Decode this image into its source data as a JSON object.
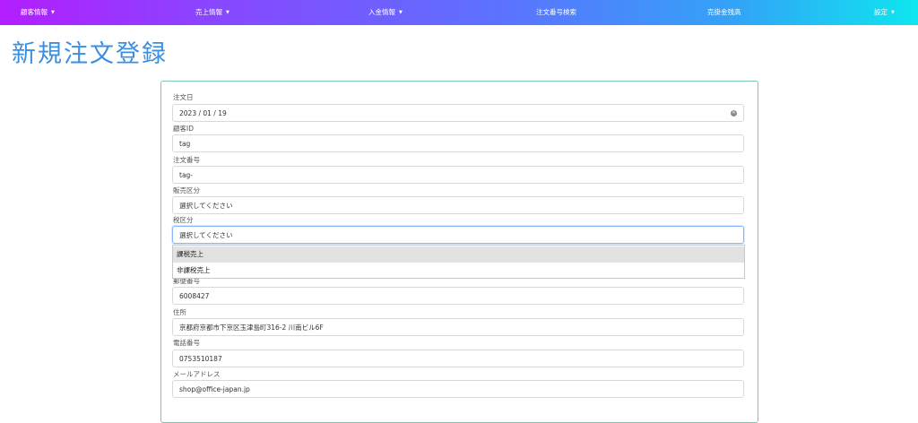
{
  "nav": {
    "customer": "顧客情報",
    "sales": "売上情報",
    "payment": "入金情報",
    "order_search": "注文番号検索",
    "receivable": "売掛金残高",
    "settings": "設定"
  },
  "page_title": "新規注文登録",
  "form": {
    "order_date_label": "注文日",
    "order_date_value": "2023 / 01 / 19",
    "customer_id_label": "顧客ID",
    "customer_id_value": "tag",
    "order_no_label": "注文番号",
    "order_no_value": "tag-",
    "sales_type_label": "販売区分",
    "sales_type_value": "選択してください",
    "tax_type_label": "税区分",
    "tax_type_value": "選択してください",
    "tax_options": [
      "課税売上",
      "非課税売上"
    ],
    "postal_label": "郵便番号",
    "postal_value": "6008427",
    "address_label": "住所",
    "address_value": "京都府京都市下京区玉津島町316-2 川南ビル6F",
    "phone_label": "電話番号",
    "phone_value": "0753510187",
    "email_label": "メールアドレス",
    "email_value": "shop@office-japan.jp"
  },
  "colors": {
    "nav_gradient_start": "#b31dff",
    "nav_gradient_end": "#0ee6ef",
    "title": "#3b8fe0",
    "card_border": "#7cc7b0",
    "focus_border": "#86b7fe"
  }
}
